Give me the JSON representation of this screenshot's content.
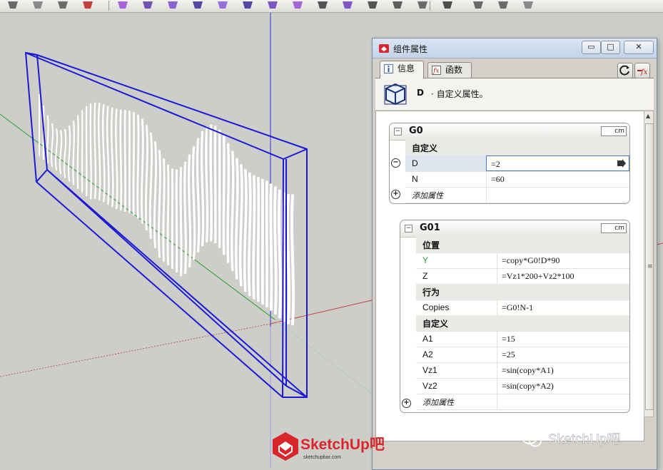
{
  "colors": {
    "viewport_bg": "#cdcdc9",
    "selection_blue": "#1b1bd6",
    "axis_red": "#c84040",
    "axis_green": "#28a028",
    "axis_blue": "#3030e0",
    "accent_green_label": "#2ea72e"
  },
  "toolbar": {
    "icons": [
      "paint-bucket-icon",
      "components-icon",
      "materials-icon",
      "ruby-icon",
      "select-icon",
      "line-icon",
      "shape-icon",
      "push-pull-icon",
      "move-icon",
      "rotate-icon",
      "scale-icon",
      "offset-icon",
      "tape-icon",
      "text-icon",
      "dimension-icon",
      "section-icon",
      "walk-icon",
      "camera-icon",
      "layer-icon",
      "warehouse-icon",
      "extension-icon"
    ]
  },
  "dialog": {
    "title": "组件属性",
    "window_buttons": {
      "minimize": "▭",
      "maximize": "□",
      "close": "✕"
    },
    "tabs": [
      {
        "label": "信息",
        "icon": "info-icon"
      },
      {
        "label": "函数",
        "icon": "function-icon"
      }
    ],
    "component": {
      "name": "D",
      "description": "· 自定义属性。"
    },
    "panels": [
      {
        "title": "G0",
        "units": "cm",
        "rows": [
          {
            "type": "section",
            "key": "自定义"
          },
          {
            "type": "attr",
            "key": "D",
            "value": "=2",
            "selected": true
          },
          {
            "type": "attr",
            "key": "N",
            "value": "=60"
          },
          {
            "type": "add",
            "key": "添加属性"
          }
        ]
      },
      {
        "title": "G01",
        "units": "cm",
        "rows": [
          {
            "type": "section",
            "key": "位置"
          },
          {
            "type": "attr",
            "key": "Y",
            "value": "=copy*G0!D*90",
            "green": true
          },
          {
            "type": "attr",
            "key": "Z",
            "value": "=Vz1*200+Vz2*100"
          },
          {
            "type": "section",
            "key": "行为"
          },
          {
            "type": "attr",
            "key": "Copies",
            "value": "=G0!N-1"
          },
          {
            "type": "section",
            "key": "自定义"
          },
          {
            "type": "attr",
            "key": "A1",
            "value": "=15"
          },
          {
            "type": "attr",
            "key": "A2",
            "value": "=25"
          },
          {
            "type": "attr",
            "key": "Vz1",
            "value": "=sin(copy*A1)"
          },
          {
            "type": "attr",
            "key": "Vz2",
            "value": "=sin(copy*A2)"
          },
          {
            "type": "add",
            "key": "添加属性"
          }
        ]
      }
    ]
  },
  "watermarks": {
    "left_brand": "SketchUp吧",
    "left_url": "sketchupbar.com",
    "right_brand": "SketchUp吧"
  },
  "model": {
    "fin_count": 60
  }
}
